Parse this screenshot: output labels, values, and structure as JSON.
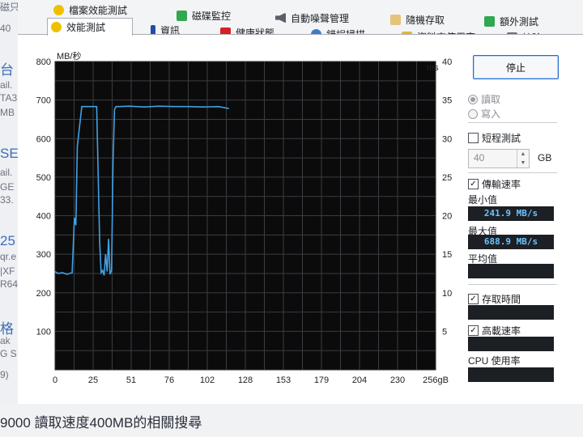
{
  "background": {
    "left_fragments": [
      "磁只",
      "40",
      "台",
      "ail.",
      "TA3",
      "MB",
      "SE",
      "ail.",
      "GE",
      "33.",
      "25",
      "qr.e",
      "|XF",
      "R64",
      "格",
      "ak",
      "G S",
      "9)"
    ],
    "caption": "9000 讀取速度400MB的相關搜尋"
  },
  "tabs_top": [
    {
      "label": "檔案效能測試",
      "icon": "shield-yellow-icon"
    },
    {
      "label": "磁碟監控",
      "icon": "chart-green-icon"
    },
    {
      "label": "自動噪聲管理",
      "icon": "speaker-icon"
    },
    {
      "label": "隨機存取",
      "icon": "grid-icon"
    },
    {
      "label": "額外測試",
      "icon": "table-icon"
    }
  ],
  "tabs_bottom": [
    {
      "label": "效能測試",
      "icon": "shield-yellow-icon",
      "active": true
    },
    {
      "label": "資訊",
      "icon": "info-icon"
    },
    {
      "label": "健康狀態",
      "icon": "red-cross-icon"
    },
    {
      "label": "錯誤掃描",
      "icon": "magnifier-icon"
    },
    {
      "label": "資料夾使用率",
      "icon": "folder-icon"
    },
    {
      "label": "抹除",
      "icon": "trash-icon"
    }
  ],
  "panel": {
    "stop_label": "停止",
    "read_label": "讀取",
    "write_label": "寫入",
    "short_test_label": "短程測試",
    "short_test_value": "40",
    "gb_label": "GB",
    "transfer_label": "傳輸速率",
    "min_label": "最小值",
    "min_value": "241.9 MB/s",
    "max_label": "最大值",
    "max_value": "688.9 MB/s",
    "avg_label": "平均值",
    "avg_value": "",
    "access_label": "存取時間",
    "access_value": "",
    "burst_label": "高載速率",
    "burst_value": "",
    "cpu_label": "CPU 使用率",
    "cpu_value": ""
  },
  "chart_data": {
    "type": "line",
    "ylabel": "MB/秒",
    "y2label": "ms",
    "ylim": [
      0,
      800
    ],
    "y2lim": [
      0,
      40
    ],
    "xlim": [
      0,
      256
    ],
    "x_unit": "gB",
    "x_ticks": [
      "0",
      "25",
      "51",
      "76",
      "102",
      "128",
      "153",
      "179",
      "204",
      "230",
      "256gB"
    ],
    "y_ticks": [
      "800",
      "700",
      "600",
      "500",
      "400",
      "300",
      "200",
      "100"
    ],
    "y2_ticks": [
      "40",
      "35",
      "30",
      "25",
      "20",
      "15",
      "10",
      "5"
    ],
    "colors": {
      "background": "#0b0b0c",
      "grid": "#3a3d42",
      "line": "#3fa2e6"
    },
    "series": [
      {
        "x": [
          0,
          2,
          5,
          8,
          11.5,
          13,
          14,
          15,
          18,
          24,
          28,
          30,
          31,
          32,
          33,
          34,
          35,
          36,
          37,
          38,
          39,
          40,
          41,
          43,
          50,
          60,
          70,
          80,
          90,
          100,
          110,
          117
        ],
        "y": [
          255,
          250,
          252,
          248,
          252,
          395,
          375,
          580,
          683,
          683,
          683,
          330,
          252,
          258,
          245,
          300,
          255,
          340,
          248,
          258,
          540,
          675,
          683,
          683,
          684,
          682,
          684,
          683,
          683,
          682,
          683,
          678
        ]
      }
    ]
  }
}
